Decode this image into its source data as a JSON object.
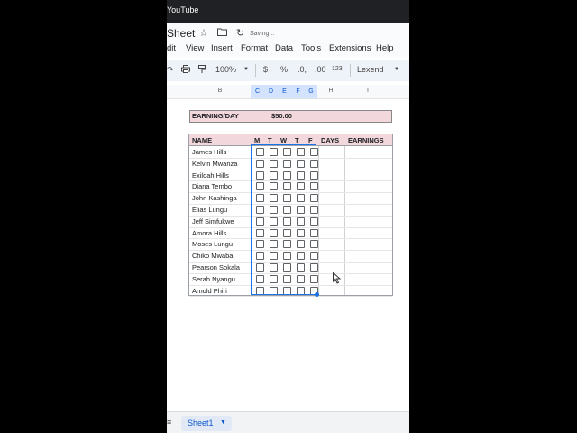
{
  "app": {
    "youtube_label": "YouTube",
    "doc_title": "Sheet",
    "saving_status": "Saving..."
  },
  "menu": [
    "dit",
    "View",
    "Insert",
    "Format",
    "Data",
    "Tools",
    "Extensions",
    "Help"
  ],
  "toolbar": {
    "zoom": "100%",
    "currency": "$",
    "percent": "%",
    "dec_dec": ".0,",
    "dec_inc": ".00",
    "number_format": "123",
    "font": "Lexend"
  },
  "columns": [
    "B",
    "C",
    "D",
    "E",
    "F",
    "G",
    "H",
    "I"
  ],
  "earning": {
    "label": "EARNING/DAY",
    "value": "$50.00"
  },
  "table": {
    "headers": {
      "name": "NAME",
      "m": "M",
      "t1": "T",
      "w": "W",
      "t2": "T",
      "f": "F",
      "days": "DAYS",
      "earnings": "EARNINGS"
    },
    "rows": [
      "James Hills",
      "Kelvin Mwanza",
      "Exildah Hills",
      "Diana Tembo",
      "John Kashinga",
      "Elias Lungu",
      "Jeff Simfukwe",
      "Amora Hills",
      "Moses Lungu",
      "Chiko Mwaba",
      "Pearson Sokala",
      "Serah Nyangu",
      "Arnold Phiri"
    ]
  },
  "sheets": {
    "active": "Sheet1"
  },
  "icons": [
    "star-icon",
    "folder-move-icon",
    "sync-icon",
    "redo-icon",
    "print-icon",
    "paint-format-icon",
    "dropdown-caret-icon",
    "all-sheets-icon"
  ]
}
